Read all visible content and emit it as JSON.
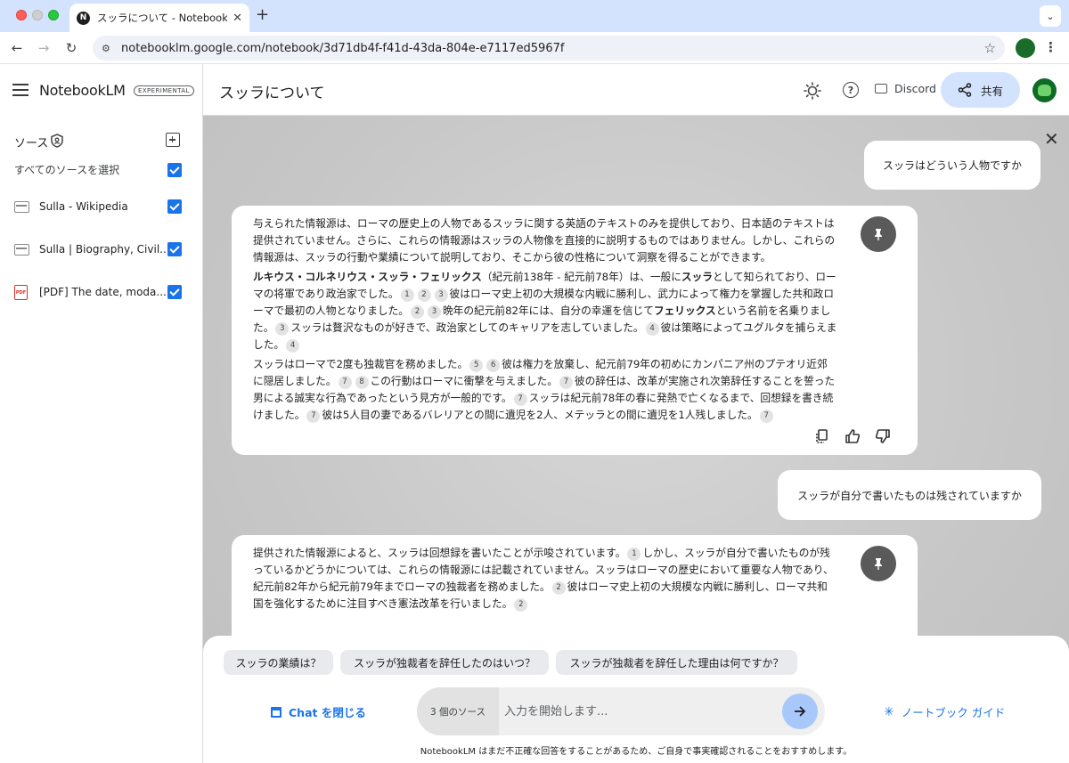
{
  "browser": {
    "tab_title": "スッラについて - NotebookLM",
    "tab_favicon": "N",
    "url": "notebooklm.google.com/notebook/3d71db4f-f41d-43da-804e-e7117ed5967f"
  },
  "sidebar": {
    "logo": "NotebookLM",
    "badge": "EXPERIMENTAL",
    "sources_label": "ソース",
    "select_all": "すべてのソースを選択",
    "items": [
      {
        "label": "Sulla - Wikipedia",
        "icon": "web-page-icon"
      },
      {
        "label": "Sulla | Biography, Civil...",
        "icon": "web-page-icon"
      },
      {
        "label": "[PDF] The date, moda...",
        "icon": "pdf-icon"
      }
    ]
  },
  "header": {
    "title": "スッラについて",
    "discord": "Discord",
    "share": "共有"
  },
  "chat": {
    "q1": "スッラはどういう人物ですか",
    "a1": {
      "p1": "与えられた情報源は、ローマの歴史上の人物であるスッラに関する英語のテキストのみを提供しており、日本語のテキストは提供されていません。さらに、これらの情報源はスッラの人物像を直接的に説明するものではありません。しかし、これらの情報源は、スッラの行動や業績について説明しており、そこから彼の性格について洞察を得ることができます。",
      "p2_bold_name": "ルキウス・コルネリウス・スッラ・フェリックス",
      "p2_a": "（紀元前138年 - 紀元前78年）は、一般に",
      "p2_bold_sulla": "スッラ",
      "p2_b": "として知られており、ローマの将軍であり政治家でした。",
      "p2_c": "彼はローマ史上初の大規模な内戦に勝利し、武力によって権力を掌握した共和政ローマで最初の人物となりました。",
      "p2_d": "晩年の紀元前82年には、自分の幸運を信じて",
      "p2_bold_felix": "フェリックス",
      "p2_e": "という名前を名乗りました。",
      "p2_f": "スッラは贅沢なものが好きで、政治家としてのキャリアを志していました。",
      "p2_g": "彼は策略によってユグルタを捕らえました。",
      "p3_a": "スッラはローマで2度も独裁官を務めました。",
      "p3_b": "彼は権力を放棄し、紀元前79年の初めにカンパニア州のプテオリ近郊に隠居しました。",
      "p3_c": "この行動はローマに衝撃を与えました。",
      "p3_d": "彼の辞任は、改革が実施され次第辞任することを誓った男による誠実な行為であったという見方が一般的です。",
      "p3_e": "スッラは紀元前78年の春に発熱で亡くなるまで、回想録を書き続けました。",
      "p3_f": "彼は5人目の妻であるバレリアとの間に遺児を2人、メテッラとの間に遺児を1人残しました。"
    },
    "q2": "スッラが自分で書いたものは残されていますか",
    "a2": {
      "a": "提供された情報源によると、スッラは回想録を書いたことが示唆されています。",
      "b": "しかし、スッラが自分で書いたものが残っているかどうかについては、これらの情報源には記載されていません。スッラはローマの歴史において重要な人物であり、紀元前82年から紀元前79年までローマの独裁者を務めました。",
      "c": "彼はローマ史上初の大規模な内戦に勝利し、ローマ共和国を強化するために注目すべき憲法改革を行いました。"
    }
  },
  "composer": {
    "suggestions": [
      "スッラの業績は？",
      "スッラが独裁者を辞任したのはいつ？",
      "スッラが独裁者を辞任した理由は何ですか？"
    ],
    "close_chat": "Chat を閉じる",
    "source_count": "3 個のソース",
    "placeholder": "入力を開始します...",
    "guide": "ノートブック ガイド",
    "disclaimer": "NotebookLM はまだ不正確な回答をすることがあるため、ご自身で事実確認されることをおすすめします。"
  }
}
